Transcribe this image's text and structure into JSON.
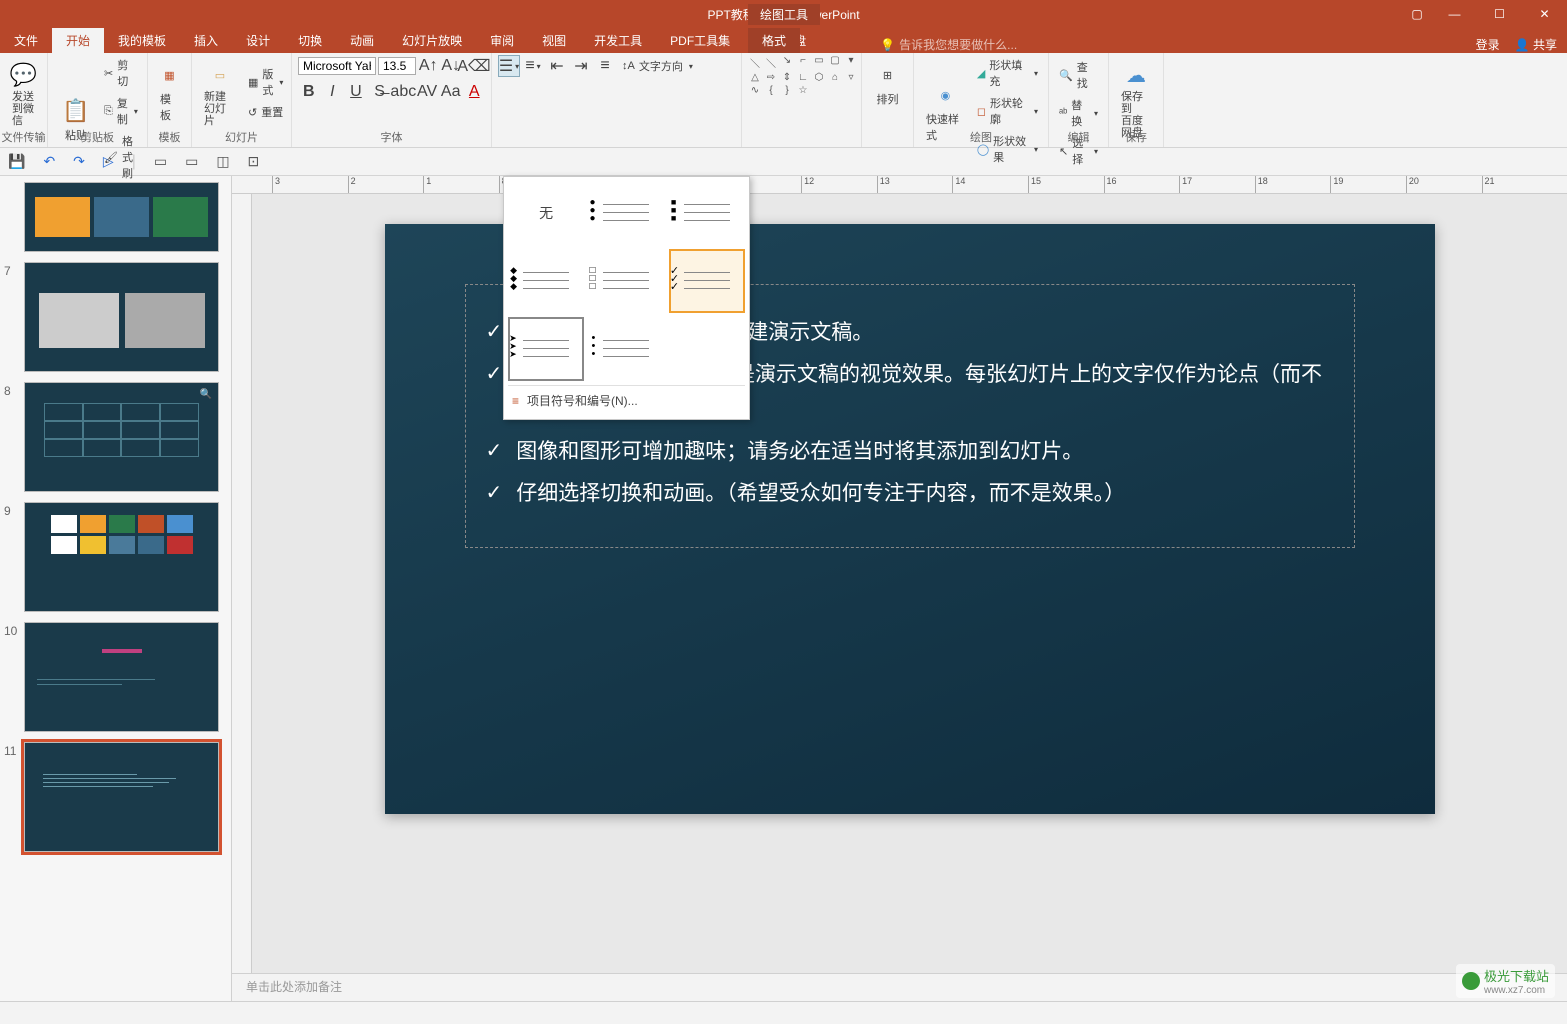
{
  "app": {
    "filename": "PPT教程2.pptx",
    "appname": "PowerPoint",
    "contextTab": "绘图工具"
  },
  "tabs": {
    "file": "文件",
    "home": "开始",
    "templates": "我的模板",
    "insert": "插入",
    "design": "设计",
    "transitions": "切换",
    "animations": "动画",
    "slideshow": "幻灯片放映",
    "review": "审阅",
    "view": "视图",
    "developer": "开发工具",
    "pdf": "PDF工具集",
    "baidu": "百度网盘",
    "format": "格式",
    "tellme": "告诉我您想要做什么...",
    "login": "登录",
    "share": "共享"
  },
  "ribbon": {
    "wechat": {
      "label": "发送\n到微信",
      "group": "文件传输"
    },
    "clipboard": {
      "paste": "粘贴",
      "cut": "剪切",
      "copy": "复制",
      "formatPainter": "格式刷",
      "group": "剪贴板"
    },
    "templatesGroup": {
      "template": "模板",
      "group": "模板"
    },
    "slides": {
      "newSlide": "新建\n幻灯片",
      "layout": "版式",
      "reset": "重置",
      "group": "幻灯片"
    },
    "font": {
      "name": "Microsoft YaH",
      "size": "13.5",
      "group": "字体"
    },
    "arrange": {
      "label": "排列"
    },
    "quickStyle": {
      "label": "快速样式"
    },
    "shapeFill": "形状填充",
    "shapeOutline": "形状轮廓",
    "shapeEffects": "形状效果",
    "drawGroup": "绘图",
    "find": "查找",
    "replace": "替换",
    "select": "选择",
    "editGroup": "编辑",
    "baiduSave": "保存到\n百度网盘",
    "baiduGroup": "保存",
    "textDirection": "文字方向"
  },
  "bulletPopup": {
    "none": "无",
    "moreOptions": "项目符号和编号(N)..."
  },
  "thumbs": {
    "n7": "7",
    "n8": "8",
    "n9": "9",
    "n10": "10",
    "n11": "11"
  },
  "slideContent": {
    "b1": "照每张幻灯片上的说明创建演示文稿。",
    "b2": "请记住 POWERPOINT 是演示文稿的视觉效果。每张幻灯片上的文字仅作为论点（而不是你要说的所有内容）。",
    "b3": "图像和图形可增加趣味；请务必在适当时将其添加到幻灯片。",
    "b4": "仔细选择切换和动画。（希望受众如何专注于内容，而不是效果。）"
  },
  "notes": {
    "placeholder": "单击此处添加备注"
  },
  "watermark": {
    "site": "极光下载站",
    "url": "www.xz7.com"
  }
}
